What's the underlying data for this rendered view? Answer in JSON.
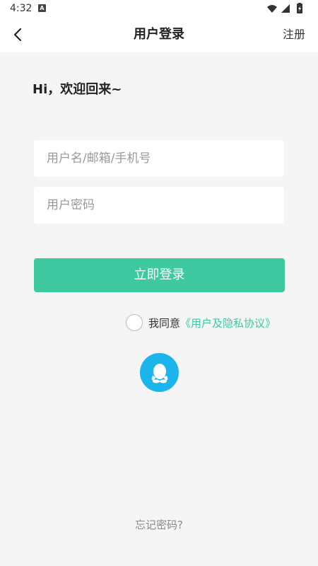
{
  "status_bar": {
    "time": "4:32",
    "app_icon_letter": "A"
  },
  "header": {
    "title": "用户登录",
    "register_label": "注册"
  },
  "greeting": "Hi，欢迎回来~",
  "form": {
    "username_placeholder": "用户名/邮箱/手机号",
    "password_placeholder": "用户密码",
    "login_label": "立即登录"
  },
  "agreement": {
    "prefix": "我同意",
    "link_label": "《用户及隐私协议》"
  },
  "forgot_label": "忘记密码?",
  "colors": {
    "accent": "#3ec9a0",
    "qq_blue": "#1bb5ec",
    "background": "#f5f5f5"
  }
}
